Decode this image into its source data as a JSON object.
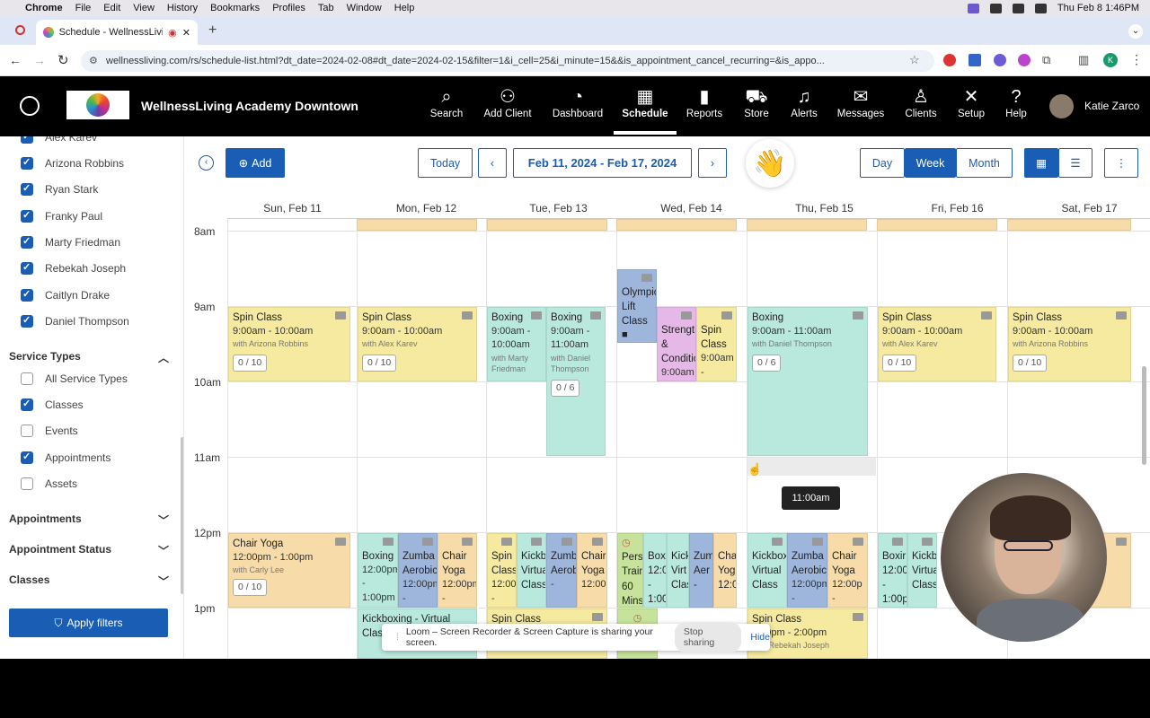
{
  "mac_menu": {
    "apple": "",
    "app": "Chrome",
    "items": [
      "File",
      "Edit",
      "View",
      "History",
      "Bookmarks",
      "Profiles",
      "Tab",
      "Window",
      "Help"
    ],
    "clock": "Thu Feb 8  1:46PM"
  },
  "browser": {
    "tab_title": "Schedule - WellnessLivin",
    "url": "wellnessliving.com/rs/schedule-list.html?dt_date=2024-02-08#dt_date=2024-02-15&filter=1&i_cell=25&i_minute=15&&is_appointment_cancel_recurring=&is_appo...",
    "profile_initial": "K"
  },
  "app": {
    "brand": "WellnessLiving Academy Downtown",
    "nav": [
      {
        "label": "Search",
        "icon": "search-icon"
      },
      {
        "label": "Add Client",
        "icon": "add-user-icon"
      },
      {
        "label": "Dashboard",
        "icon": "dashboard-icon"
      },
      {
        "label": "Schedule",
        "icon": "calendar-icon"
      },
      {
        "label": "Reports",
        "icon": "chart-icon"
      },
      {
        "label": "Store",
        "icon": "cart-icon"
      },
      {
        "label": "Alerts",
        "icon": "bell-icon"
      },
      {
        "label": "Messages",
        "icon": "chat-icon"
      },
      {
        "label": "Clients",
        "icon": "person-icon"
      },
      {
        "label": "Setup",
        "icon": "tools-icon"
      },
      {
        "label": "Help",
        "icon": "question-icon"
      }
    ],
    "user_name": "Katie Zarco"
  },
  "sidebar": {
    "staff": [
      {
        "label": "Alex Karev",
        "checked": true
      },
      {
        "label": "Arizona Robbins",
        "checked": true
      },
      {
        "label": "Ryan Stark",
        "checked": true
      },
      {
        "label": "Franky Paul",
        "checked": true
      },
      {
        "label": "Marty Friedman",
        "checked": true
      },
      {
        "label": "Rebekah Joseph",
        "checked": true
      },
      {
        "label": "Caitlyn Drake",
        "checked": true
      },
      {
        "label": "Daniel Thompson",
        "checked": true
      }
    ],
    "service_types_title": "Service Types",
    "service_types": [
      {
        "label": "All Service Types",
        "checked": false
      },
      {
        "label": "Classes",
        "checked": true
      },
      {
        "label": "Events",
        "checked": false
      },
      {
        "label": "Appointments",
        "checked": true
      },
      {
        "label": "Assets",
        "checked": false
      }
    ],
    "sections": [
      "Appointments",
      "Appointment Status",
      "Classes"
    ],
    "apply_label": "Apply filters"
  },
  "toolbar": {
    "add_label": "Add",
    "today_label": "Today",
    "date_range": "Feb 11, 2024 - Feb 17, 2024",
    "views": [
      "Day",
      "Week",
      "Month"
    ],
    "active_view": "Week",
    "emoji": "👋"
  },
  "calendar": {
    "days": [
      "Sun, Feb 11",
      "Mon, Feb 12",
      "Tue, Feb 13",
      "Wed, Feb 14",
      "Thu, Feb 15",
      "Fri, Feb 16",
      "Sat, Feb 17"
    ],
    "hours": [
      "8am",
      "9am",
      "10am",
      "11am",
      "12pm",
      "1pm"
    ],
    "tooltip": "11:00am"
  },
  "events": {
    "sun_spin": {
      "title": "Spin Class",
      "time": "9:00am - 10:00am",
      "with": "with Arizona Robbins",
      "cap": "0 / 10"
    },
    "mon_spin": {
      "title": "Spin Class",
      "time": "9:00am - 10:00am",
      "with": "with Alex Karev",
      "cap": "0 / 10"
    },
    "tue_box1": {
      "title": "Boxing",
      "time": "9:00am - 10:00am",
      "with": "with Marty Friedman"
    },
    "tue_box2": {
      "title": "Boxing",
      "time": "9:00am - 11:00am",
      "with": "with Daniel Thompson",
      "cap": "0 / 6"
    },
    "wed_oly": {
      "title": "Olympic Lift Class"
    },
    "wed_str": {
      "title": "Strength & Conditio",
      "time": "9:00am"
    },
    "wed_spin": {
      "title": "Spin Class",
      "time": "9:00am -"
    },
    "thu_box": {
      "title": "Boxing",
      "time": "9:00am - 11:00am",
      "with": "with Daniel Thompson",
      "cap": "0 / 6"
    },
    "fri_spin": {
      "title": "Spin Class",
      "time": "9:00am - 10:00am",
      "with": "with Alex Karev",
      "cap": "0 / 10"
    },
    "sat_spin": {
      "title": "Spin Class",
      "time": "9:00am - 10:00am",
      "with": "with Arizona Robbins",
      "cap": "0 / 10"
    },
    "sun_chair": {
      "title": "Chair Yoga",
      "time": "12:00pm - 1:00pm",
      "with": "with Carly Lee",
      "cap": "0 / 10"
    },
    "mon_box": {
      "title": "Boxing",
      "time": "12:00pm - 1:00pm"
    },
    "mon_zumba": {
      "title": "Zumba Aerobic",
      "time": "12:00pm -"
    },
    "mon_chair": {
      "title": "Chair Yoga",
      "time": "12:00pm -"
    },
    "mon_kick": {
      "title": "Kickboxing - Virtual Class"
    },
    "tue_spin": {
      "title": "Spin Class",
      "time": "12:00pm -"
    },
    "tue_kick": {
      "title": "Kickb Virtual Class"
    },
    "tue_zumba": {
      "title": "Zumb Aerob",
      "time": "-"
    },
    "tue_chair": {
      "title": "Chair Yoga",
      "time": "12:00"
    },
    "tue_spin2": {
      "title": "Spin Class"
    },
    "wed_pers": {
      "title": "Pers Train 60 Mins"
    },
    "wed_box": {
      "title": "Box 12:0 - 1:00"
    },
    "wed_kick": {
      "title": "Kick Virt Clas"
    },
    "wed_zum": {
      "title": "Zum Aer -"
    },
    "wed_cha": {
      "title": "Cha Yog 12:0"
    },
    "thu_kick": {
      "title": "Kickbox Virtual Class"
    },
    "thu_zumba": {
      "title": "Zumba Aerobic",
      "time": "12:00pm -"
    },
    "thu_chair": {
      "title": "Chair Yoga",
      "time": "12:00p -"
    },
    "thu_spin": {
      "title": "Spin Class",
      "time": "1:00pm - 2:00pm",
      "with": "with Rebekah Joseph"
    },
    "fri_box": {
      "title": "Boxir 12:00 - 1:00p"
    },
    "fri_kick": {
      "title": "Kickb Virtua Class"
    }
  },
  "loom": {
    "message": "Loom – Screen Recorder & Screen Capture is sharing your screen.",
    "stop_label": "Stop sharing",
    "hide_label": "Hide"
  }
}
